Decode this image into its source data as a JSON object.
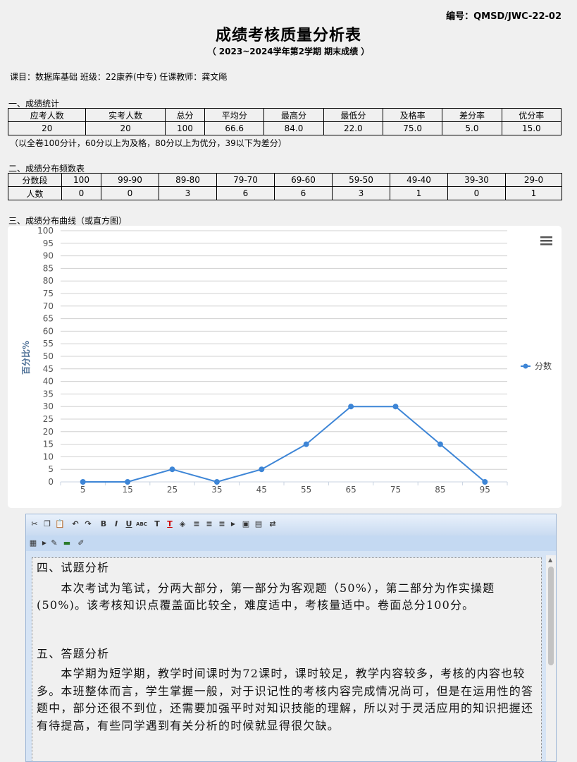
{
  "doc_no": "编号：QMSD/JWC-22-02",
  "title": "成绩考核质量分析表",
  "subtitle": "（ 2023~2024学年第2学期   期末成绩 ）",
  "course_info": "课目：数据库基础 班级：22康养(中专) 任课教师：龚文飚",
  "sections": {
    "stats": "一、成绩统计",
    "distribution": "二、成绩分布频数表",
    "curve": "三、成绩分布曲线（或直方图）"
  },
  "stats_table": {
    "headers": [
      "应考人数",
      "实考人数",
      "总分",
      "平均分",
      "最高分",
      "最低分",
      "及格率",
      "差分率",
      "优分率"
    ],
    "values": [
      "20",
      "20",
      "100",
      "66.6",
      "84.0",
      "22.0",
      "75.0",
      "5.0",
      "15.0"
    ]
  },
  "stats_note": "（以全卷100分计，60分以上为及格，80分以上为优分，39以下为差分）",
  "dist_table": {
    "row1_label": "分数段",
    "row2_label": "人数",
    "ranges": [
      "100",
      "99-90",
      "89-80",
      "79-70",
      "69-60",
      "59-50",
      "49-40",
      "39-30",
      "29-0"
    ],
    "counts": [
      "0",
      "0",
      "3",
      "6",
      "6",
      "3",
      "1",
      "0",
      "1"
    ]
  },
  "chart_data": {
    "type": "line",
    "x": [
      5,
      15,
      25,
      35,
      45,
      55,
      65,
      75,
      85,
      95
    ],
    "series": [
      {
        "name": "分数",
        "values": [
          0,
          0,
          5,
          0,
          5,
          15,
          30,
          30,
          15,
          0
        ]
      }
    ],
    "ylabel": "百分比%",
    "ylim": [
      0,
      100
    ],
    "yticks": [
      0,
      5,
      10,
      15,
      20,
      25,
      30,
      35,
      40,
      45,
      50,
      55,
      60,
      65,
      70,
      75,
      80,
      85,
      90,
      95,
      100
    ],
    "grid": true,
    "legend": "right",
    "color": "#3d85d6"
  },
  "editor": {
    "heading4": "四、试题分析",
    "para4": "　　本次考试为笔试，分两大部分，第一部分为客观题（50%），第二部分为作实操题(50%)。该考核知识点覆盖面比较全，难度适中，考核量适中。卷面总分100分。",
    "heading5": "五、答题分析",
    "para5": "　　本学期为短学期，教学时间课时为72课时，课时较足，教学内容较多，考核的内容也较多。本班整体而言，学生掌握一般，对于识记性的考核内容完成情况尚可，但是在运用性的答题中，部分还很不到位，还需要加强平时对知识技能的理解，所以对于灵活应用的知识把握还有待提高，有些同学遇到有关分析的时候就显得很欠缺。"
  },
  "menu_icon": "hamburger-icon"
}
